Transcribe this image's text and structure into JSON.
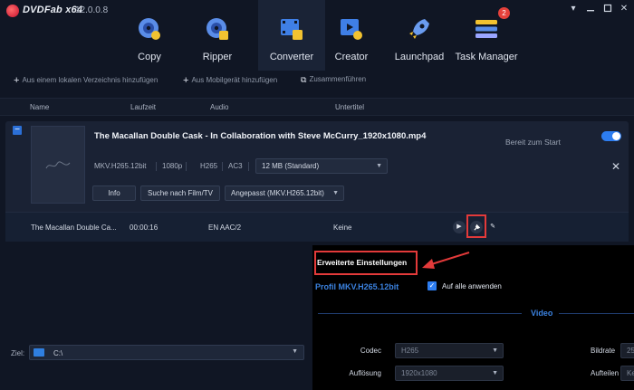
{
  "app": {
    "name": "DVDFab x64",
    "version": "12.0.0.8"
  },
  "nav": [
    {
      "label": "Copy",
      "icon": "copy-disc-icon"
    },
    {
      "label": "Ripper",
      "icon": "ripper-disc-icon"
    },
    {
      "label": "Converter",
      "icon": "converter-film-icon",
      "active": true
    },
    {
      "label": "Creator",
      "icon": "creator-film-icon"
    },
    {
      "label": "Launchpad",
      "icon": "rocket-icon"
    },
    {
      "label": "Task Manager",
      "icon": "task-manager-icon",
      "badge": "2"
    }
  ],
  "toolbar": {
    "add_local": "Aus einem lokalen Verzeichnis hinzufügen",
    "add_mobile": "Aus Mobilgerät hinzufügen",
    "merge": "Zusammenführen"
  },
  "columns": {
    "name": "Name",
    "duration": "Laufzeit",
    "audio": "Audio",
    "subtitle": "Untertitel"
  },
  "file": {
    "title": "The Macallan Double Cask - In Collaboration with Steve McCurry_1920x1080.mp4",
    "status": "Bereit zum Start",
    "profile": "MKV.H265.12bit",
    "resolution": "1080p",
    "codec": "H265",
    "audio_codec": "AC3",
    "size_option": "12 MB (Standard)",
    "info_button": "Info",
    "search_button": "Suche nach Film/TV",
    "custom_option": "Angepasst (MKV.H265.12bit)",
    "track_name": "The Macallan Double Ca...",
    "track_duration": "00:00:16",
    "track_audio": "EN  AAC/2",
    "track_subtitle": "Keine"
  },
  "bottom": {
    "label": "Ziel:",
    "path": "C:\\"
  },
  "advanced": {
    "title": "Erweiterte Einstellungen",
    "profile": "Profil MKV.H265.12bit",
    "apply_all": "Auf alle anwenden",
    "section": "Video",
    "codec_label": "Codec",
    "codec_value": "H265",
    "resolution_label": "Auflösung",
    "resolution_value": "1920x1080",
    "framerate_label": "Bildrate",
    "framerate_value": "25",
    "split_label": "Aufteilen",
    "split_value": "Ke"
  },
  "colors": {
    "accent": "#2d7df0",
    "highlight": "#e33a3a",
    "profile_blue": "#3b82e0"
  }
}
